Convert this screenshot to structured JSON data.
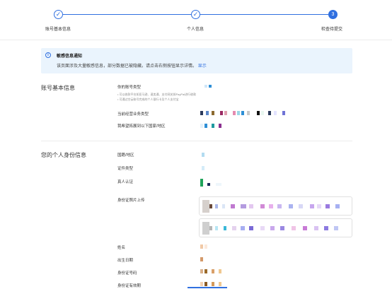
{
  "stepper": {
    "steps": [
      {
        "label": "账号基本信息",
        "state": "done",
        "icon": "check-icon"
      },
      {
        "label": "个人信息",
        "state": "done",
        "icon": "check-icon"
      },
      {
        "label": "检查待提交",
        "state": "active",
        "number": "3"
      }
    ],
    "accent": "#2f6fe0"
  },
  "notice": {
    "icon": "info-icon",
    "title": "敏感信息通知",
    "text": "该页面涉及大量敏感信息，部分数据已被隐藏。请点击右侧按钮显示详情。",
    "link": "显示"
  },
  "account_section": {
    "title": "账号基本信息",
    "fields": [
      {
        "label": "你的账号类型"
      },
      {
        "label": "当前经营业务类型"
      },
      {
        "label": "我希望拓展到以下国家/地区"
      }
    ],
    "hint_lines": [
      "• 可以收款平台如亚马逊、速卖通、支付网关如PayPal进行收款",
      "• 可通过空云账号完成的个人银行卡及个人支付宝"
    ]
  },
  "personal_section": {
    "title": "您的个人身份信息",
    "fields": [
      {
        "label": "国籍/地区"
      },
      {
        "label": "证件类型"
      },
      {
        "label": "真人认证"
      },
      {
        "label": "身份证照片上传"
      },
      {
        "label": "姓名"
      },
      {
        "label": "出生日期"
      },
      {
        "label": "身份证号码"
      },
      {
        "label": "身份证有效期"
      }
    ]
  },
  "colors": {
    "accent": "#2f6fe0",
    "notice_bg": "#eaf4fd",
    "divider": "#ececec"
  }
}
